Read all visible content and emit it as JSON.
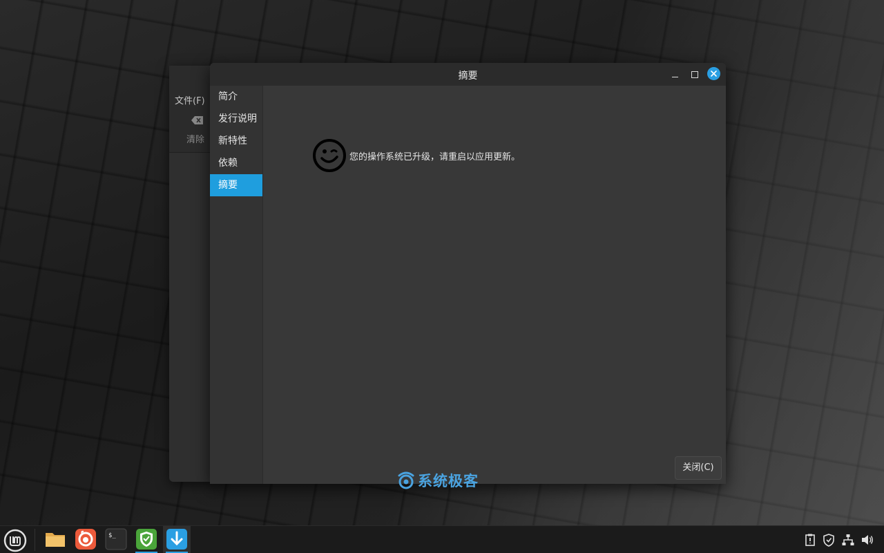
{
  "background_window": {
    "menu_file": "文件(F)",
    "clear_label": "清除"
  },
  "dialog": {
    "title": "摘要",
    "sidebar": {
      "items": [
        {
          "label": "简介",
          "active": false
        },
        {
          "label": "发行说明",
          "active": false
        },
        {
          "label": "新特性",
          "active": false
        },
        {
          "label": "依赖",
          "active": false
        },
        {
          "label": "摘要",
          "active": true
        }
      ]
    },
    "message": "您的操作系统已升级，请重启以应用更新。",
    "close_button": "关闭(C)"
  },
  "watermark": {
    "text": "系统极客"
  },
  "taskbar": {
    "apps": [
      "files-icon",
      "firefox-icon",
      "terminal-icon",
      "update-manager-shield-icon",
      "update-download-icon"
    ],
    "tray": [
      "clipboard-icon",
      "shield-icon",
      "network-icon",
      "volume-icon"
    ]
  },
  "colors": {
    "accent": "#1f9ede",
    "dialog_bg": "#383838",
    "sidebar_bg": "#333333",
    "titlebar_bg": "#2b2b2b"
  }
}
